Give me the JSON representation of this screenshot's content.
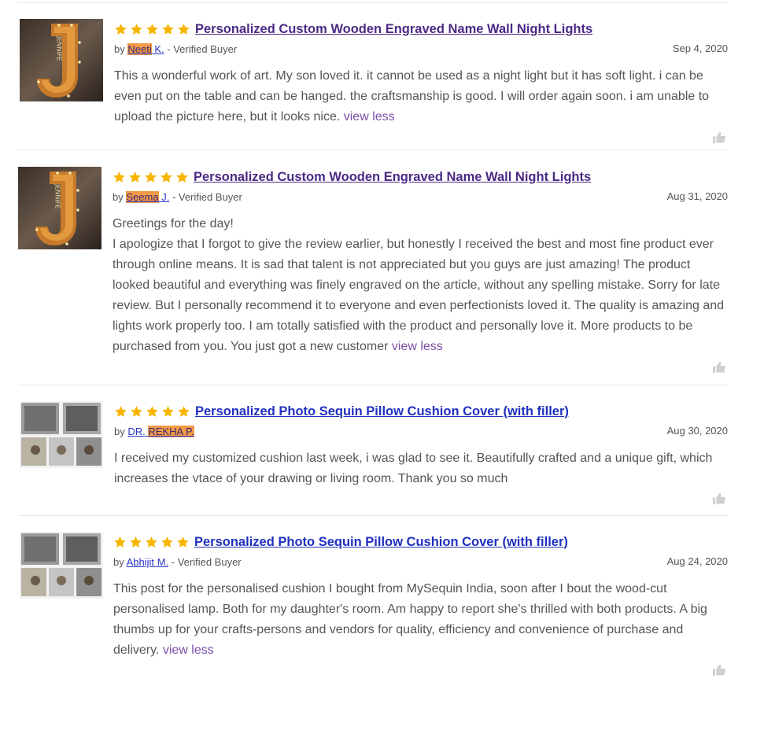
{
  "colors": {
    "accent": "#4b2a84",
    "star": "#f7b500",
    "highlight": "#f39a47",
    "link": "#2a36c8"
  },
  "reviews": [
    {
      "rating": 5,
      "product": "Personalized Custom Wooden Engraved Name Wall Night Lights",
      "by": "by",
      "author_first": "Neeti",
      "author_last": "K.",
      "verified": "- Verified Buyer",
      "date": "Sep 4, 2020",
      "text": "This a wonderful work of art. My son loved it. it cannot be used as a night light but it has soft light. i can be even put on the table and can be hanged. the craftsmanship is good. I will order again soon. i am unable to upload the picture here, but it looks nice.",
      "view_less": "view less",
      "thumb_letters": "JENNIFE"
    },
    {
      "rating": 5,
      "product": "Personalized Custom Wooden Engraved Name Wall Night Lights",
      "by": "by",
      "author_first": "Seema",
      "author_last": "J.",
      "verified": "- Verified Buyer",
      "date": "Aug 31, 2020",
      "text_first": "Greetings for the day!",
      "text": "I apologize that I forgot to give the review earlier, but honestly I received the best and most fine product ever through online means. It is sad that talent is not appreciated but you guys are just amazing! The product looked beautiful and everything was finely engraved on the article, without any spelling mistake. Sorry for late review. But I personally recommend it to everyone and even perfectionists loved it. The quality is amazing and lights work properly too. I am totally satisfied with the product and personally love it. More products to be purchased from you. You just got a new customer",
      "view_less": "view less",
      "thumb_letters": "JENNIFE"
    },
    {
      "rating": 5,
      "product": "Personalized Photo Sequin Pillow Cushion Cover (with filler)",
      "by": "by",
      "author_first": "DR.",
      "author_last": "REKHA P.",
      "date": "Aug 30, 2020",
      "text": "I received my customized cushion last week, i was glad to see it. Beautifully crafted and a unique gift, which increases the vtace of your drawing or living room. Thank you so much"
    },
    {
      "rating": 5,
      "product": "Personalized Photo Sequin Pillow Cushion Cover (with filler)",
      "by": "by",
      "author_first": "Abhijit",
      "author_last": "M.",
      "verified": "- Verified Buyer",
      "date": "Aug 24, 2020",
      "text": "This post for the personalised cushion I bought from MySequin India, soon after I bout the wood-cut personalised lamp. Both for my daughter's room. Am happy to report she's thrilled with both products. A big thumbs up for your crafts-persons and vendors for quality, efficiency and convenience of purchase and delivery.",
      "view_less": "view less"
    }
  ]
}
